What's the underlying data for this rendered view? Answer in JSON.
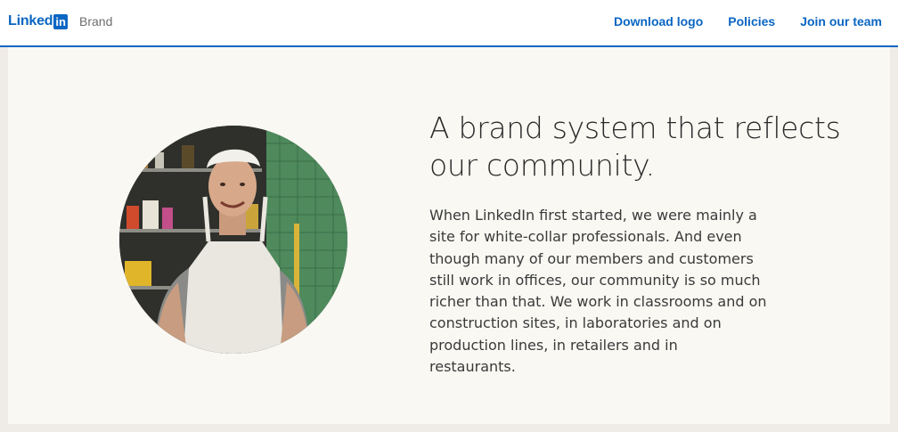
{
  "header": {
    "logo_text": "Linked",
    "logo_in": "in",
    "brand_label": "Brand",
    "nav": [
      {
        "label": "Download logo"
      },
      {
        "label": "Policies"
      },
      {
        "label": "Join our team"
      }
    ]
  },
  "hero": {
    "headline": "A brand system that reflects our community.",
    "body": "When LinkedIn first started, we were mainly a site for white-collar professionals. And even though many of our members and customers still work in offices, our community is so much richer than that. We work in classrooms and on construction sites, in laboratories and on production lines, in retailers and in restaurants."
  },
  "colors": {
    "brand_blue": "#0a66c2",
    "panel_bg": "#f9f8f3",
    "page_bg": "#efebe6"
  }
}
